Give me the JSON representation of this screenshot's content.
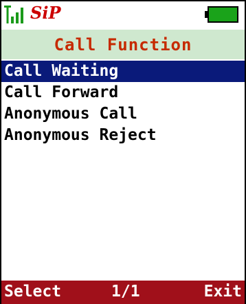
{
  "status": {
    "signal_icon": "signal-strength-icon",
    "sip_label": "SiP",
    "battery_icon": "battery-icon",
    "colors": {
      "signal": "#1a9a1a",
      "sip": "#cc0000",
      "battery_fill": "#1aa31a"
    }
  },
  "header": {
    "title": "Call Function",
    "title_color": "#c62a00",
    "background": "#cfe8cf"
  },
  "menu": {
    "items": [
      {
        "label": "Call Waiting",
        "selected": true
      },
      {
        "label": "Call Forward",
        "selected": false
      },
      {
        "label": "Anonymous Call",
        "selected": false
      },
      {
        "label": "Anonymous Reject",
        "selected": false
      }
    ],
    "selected_color": "#0a1a7a"
  },
  "softkeys": {
    "left": "Select",
    "center": "1/1",
    "right": "Exit",
    "background": "#a0101a"
  }
}
